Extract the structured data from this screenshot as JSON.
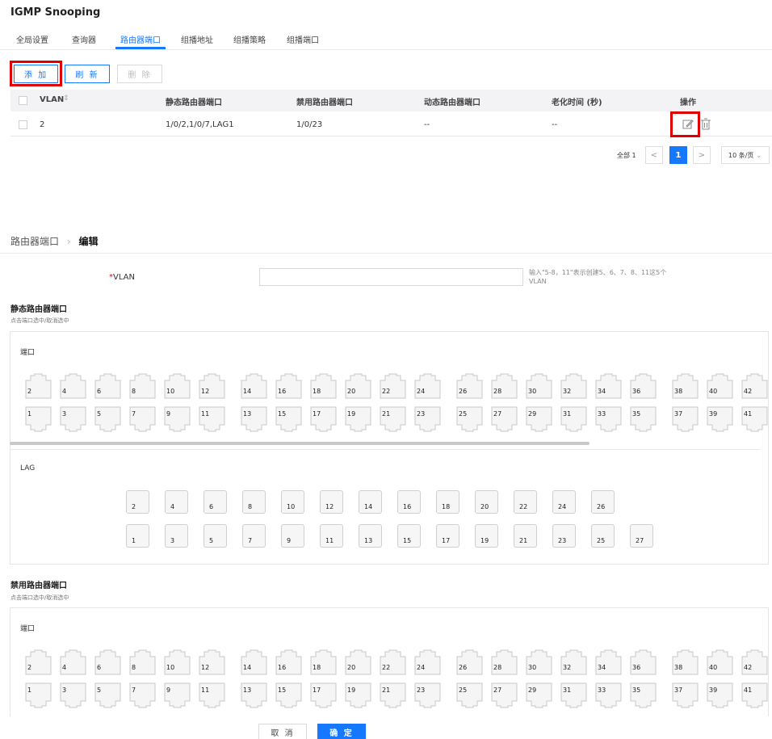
{
  "title": "IGMP Snooping",
  "tabs": [
    {
      "label": "全局设置",
      "active": false
    },
    {
      "label": "查询器",
      "active": false
    },
    {
      "label": "路由器端口",
      "active": true
    },
    {
      "label": "组播地址",
      "active": false
    },
    {
      "label": "组播策略",
      "active": false
    },
    {
      "label": "组播端口",
      "active": false
    }
  ],
  "toolbar": {
    "add": "添 加",
    "refresh": "刷 新",
    "delete": "删 除"
  },
  "table": {
    "headers": [
      "VLAN",
      "静态路由器端口",
      "禁用路由器端口",
      "动态路由器端口",
      "老化时间 (秒)",
      "操作"
    ],
    "rows": [
      {
        "vlan": "2",
        "static": "1/0/2,1/0/7,LAG1",
        "forbidden": "1/0/23",
        "dynamic": "--",
        "aging": "--"
      }
    ]
  },
  "pagination": {
    "total": "全部 1",
    "prev": "<",
    "current": "1",
    "next": ">",
    "page_size": "10 条/页"
  },
  "breadcrumb": {
    "parent": "路由器端口",
    "separator": "›",
    "current": "编辑"
  },
  "form": {
    "vlan_label": "VLAN",
    "required_mark": "*",
    "vlan_value": "",
    "vlan_hint": "输入\"5-8，11\"表示创建5、6、7、8、11这5个VLAN"
  },
  "static_section": {
    "title": "静态路由器端口",
    "subtitle": "点击端口选中/取消选中",
    "ports_label": "端口",
    "lag_label": "LAG"
  },
  "forbidden_section": {
    "title": "禁用路由器端口",
    "subtitle": "点击端口选中/取消选中",
    "ports_label": "端口"
  },
  "ports_top": [
    "2",
    "4",
    "6",
    "8",
    "10",
    "12",
    "14",
    "16",
    "18",
    "20",
    "22",
    "24",
    "26",
    "28",
    "30",
    "32",
    "34",
    "36",
    "38",
    "40",
    "42"
  ],
  "ports_bottom": [
    "1",
    "3",
    "5",
    "7",
    "9",
    "11",
    "13",
    "15",
    "17",
    "19",
    "21",
    "23",
    "25",
    "27",
    "29",
    "31",
    "33",
    "35",
    "37",
    "39",
    "41"
  ],
  "lag_top": [
    "2",
    "4",
    "6",
    "8",
    "10",
    "12",
    "14",
    "16",
    "18",
    "20",
    "22",
    "24",
    "26"
  ],
  "lag_bottom": [
    "1",
    "3",
    "5",
    "7",
    "9",
    "11",
    "13",
    "15",
    "17",
    "19",
    "21",
    "23",
    "25",
    "27"
  ],
  "footer": {
    "cancel": "取 消",
    "confirm": "确 定"
  },
  "colors": {
    "accent": "#1677ff",
    "highlight": "#e00000"
  }
}
